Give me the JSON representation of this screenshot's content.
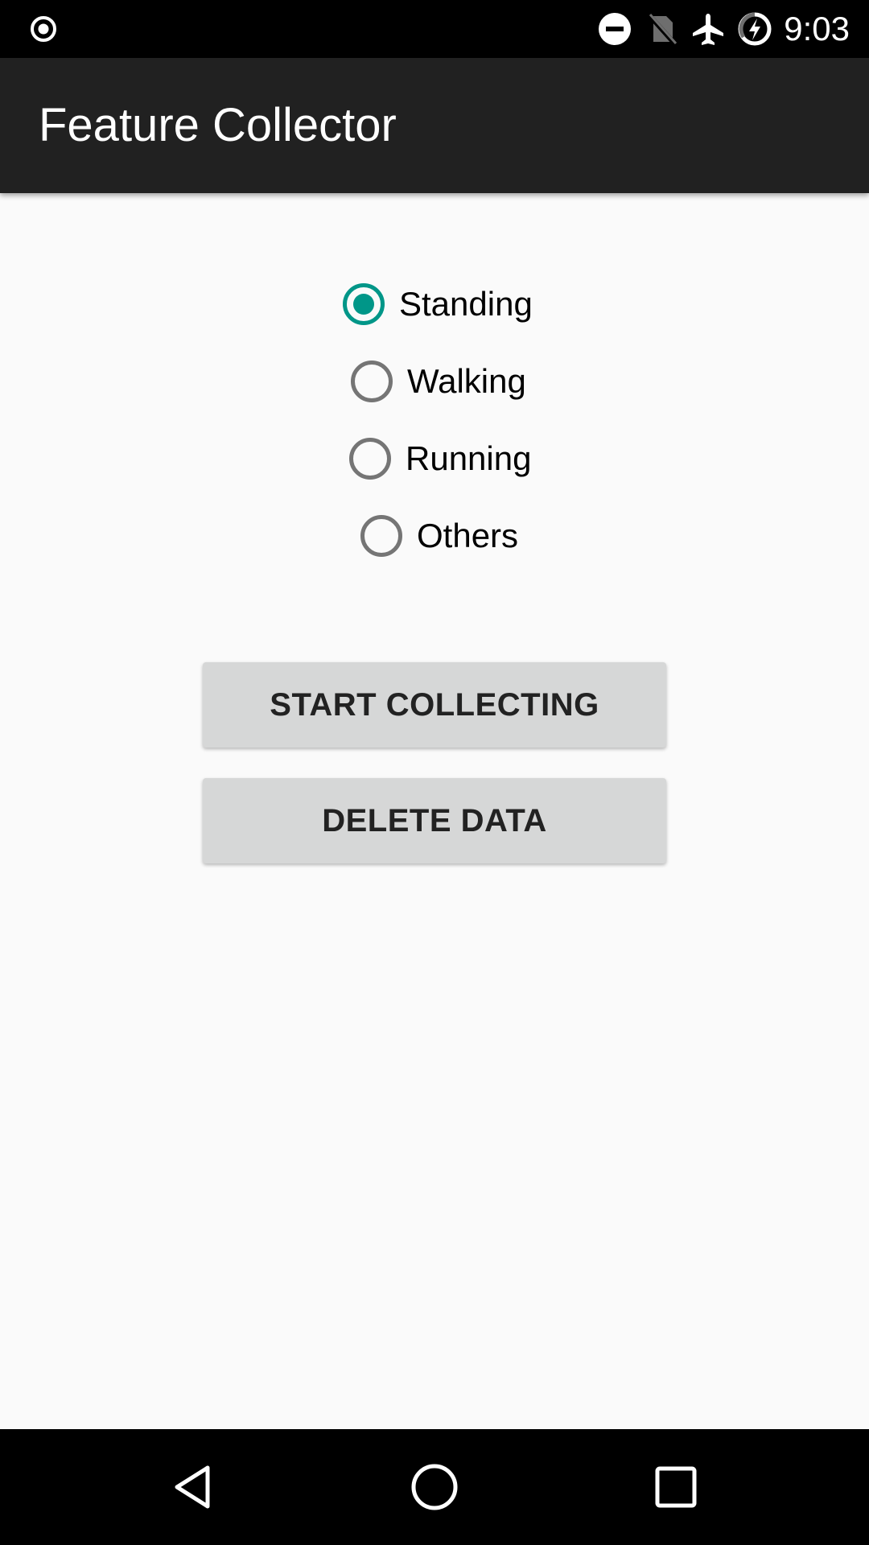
{
  "status_bar": {
    "time": "9:03",
    "icons": [
      "record-icon",
      "do-not-disturb-icon",
      "no-sim-icon",
      "airplane-mode-icon",
      "battery-charging-icon"
    ]
  },
  "app_bar": {
    "title": "Feature Collector"
  },
  "activity_options": [
    {
      "label": "Standing",
      "checked": true
    },
    {
      "label": "Walking",
      "checked": false
    },
    {
      "label": "Running",
      "checked": false
    },
    {
      "label": "Others",
      "checked": false
    }
  ],
  "buttons": {
    "start_label": "START COLLECTING",
    "delete_label": "DELETE DATA"
  },
  "nav_bar": {
    "icons": [
      "back-icon",
      "home-icon",
      "recents-icon"
    ]
  },
  "colors": {
    "accent": "#009688",
    "app_bar": "#212121",
    "background": "#fafafa",
    "button": "#d6d7d7"
  }
}
